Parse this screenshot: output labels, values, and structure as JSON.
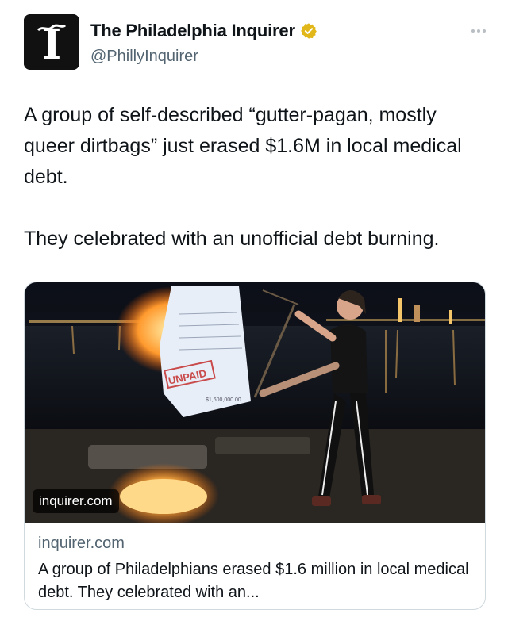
{
  "tweet": {
    "author": {
      "display_name": "The Philadelphia Inquirer",
      "handle": "@PhillyInquirer",
      "verified_color": "#E2B719",
      "avatar_icon": "inquirer-logo-icon",
      "avatar_letter": "I"
    },
    "more_icon": "more-options-icon",
    "text": [
      "A group of self-described “gutter-pagan, mostly queer dirtbags” just erased $1.6M in local medical debt.",
      "They celebrated with an unofficial debt burning."
    ],
    "card": {
      "image_badge": "inquirer.com",
      "domain": "inquirer.com",
      "title": "A group of Philadelphians erased $1.6 million in local medical debt. They celebrated with an...",
      "image_texts": {
        "stamp": "UNPAID",
        "amount": "$1,600,000.00"
      }
    }
  },
  "colors": {
    "text_primary": "#0f1419",
    "text_secondary": "#536471",
    "border": "#cfd9de"
  }
}
